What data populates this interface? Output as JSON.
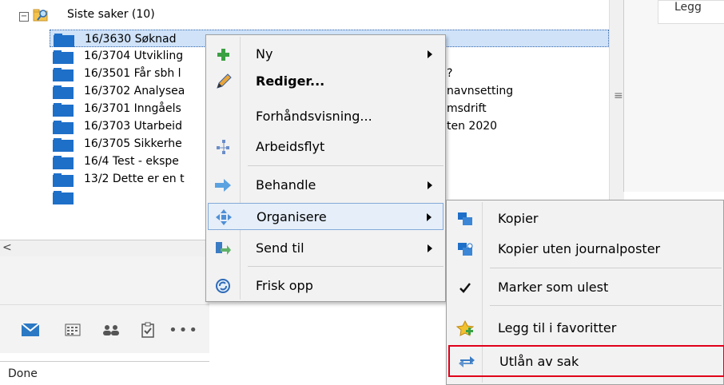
{
  "tree": {
    "root_label": "Siste saker (10)",
    "expander_symbol": "−",
    "rows": [
      {
        "left": "16/3630 Søknad",
        "right": ""
      },
      {
        "left": "16/3704 Utvikling",
        "right": ""
      },
      {
        "left": "16/3501 Får sbh l",
        "right": "?"
      },
      {
        "left": "16/3702 Analysea",
        "right": "navnsetting"
      },
      {
        "left": "16/3701 Inngåels",
        "right": "msdrift"
      },
      {
        "left": "16/3703 Utarbeid",
        "right": "ten 2020"
      },
      {
        "left": "16/3705 Sikkerhe",
        "right": ""
      },
      {
        "left": "16/4 Test - ekspe",
        "right": ""
      },
      {
        "left": "13/2 Dette er en t",
        "right": ""
      }
    ]
  },
  "right_panel": {
    "legg_label": "Legg"
  },
  "status": {
    "text": "Done"
  },
  "context_menu": {
    "items": [
      {
        "label": "Ny",
        "icon": "plus-icon",
        "submenu": true
      },
      {
        "label": "Rediger...",
        "icon": "pencil-icon",
        "bold": true
      },
      {
        "label": "Forhåndsvisning...",
        "icon": "none"
      },
      {
        "label": "Arbeidsflyt",
        "icon": "workflow-icon"
      },
      {
        "label": "Behandle",
        "icon": "arrow-right-icon",
        "submenu": true
      },
      {
        "label": "Organisere",
        "icon": "move-icon",
        "submenu": true,
        "highlighted": true
      },
      {
        "label": "Send til",
        "icon": "send-to-icon",
        "submenu": true
      },
      {
        "label": "Frisk opp",
        "icon": "refresh-icon"
      }
    ]
  },
  "sub_menu": {
    "items": [
      {
        "label": "Kopier",
        "icon": "copy-icon"
      },
      {
        "label": "Kopier uten journalposter",
        "icon": "copy-without-icon"
      },
      {
        "label": "Marker som ulest",
        "icon": "checkmark-icon"
      },
      {
        "label": "Legg til i favoritter",
        "icon": "favorite-star-icon"
      },
      {
        "label": "Utlån av sak",
        "icon": "exchange-arrows-icon",
        "highlighted": true
      }
    ]
  },
  "colors": {
    "selection": "#cfe2f8",
    "highlight_border": "#e0001a",
    "mail_blue": "#2b78c5"
  }
}
